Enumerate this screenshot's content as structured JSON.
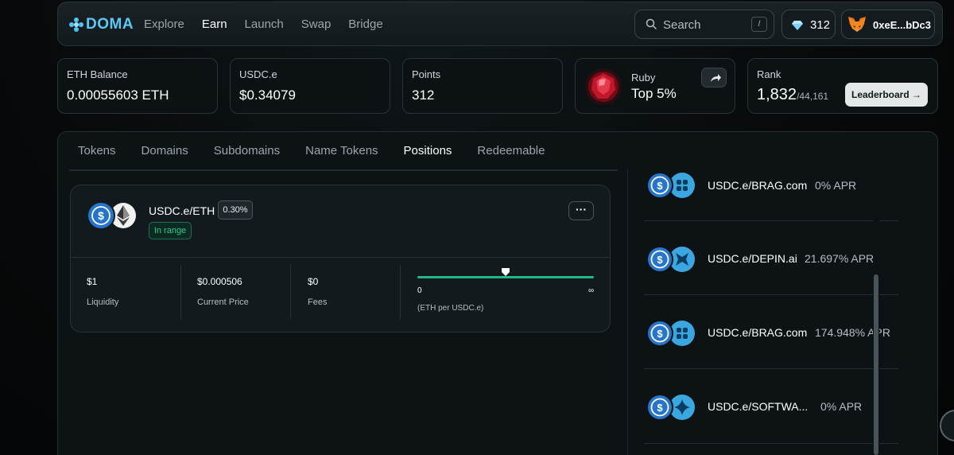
{
  "nav": {
    "logo": "DOMA",
    "links": [
      "Explore",
      "Earn",
      "Launch",
      "Swap",
      "Bridge"
    ],
    "active_link": "Earn",
    "search_placeholder": "Search",
    "search_shortcut": "/",
    "points": "312",
    "wallet": "0xeE...bDc3"
  },
  "stats": {
    "eth_balance": {
      "label": "ETH Balance",
      "value": "0.00055603 ETH"
    },
    "usdc": {
      "label": "USDC.e",
      "value": "$0.34079"
    },
    "points": {
      "label": "Points",
      "value": "312"
    },
    "ruby": {
      "label": "Ruby",
      "value": "Top 5%"
    },
    "rank": {
      "label": "Rank",
      "value": "1,832",
      "total": "/44,161",
      "button": "Leaderboard →"
    }
  },
  "tabs": [
    "Tokens",
    "Domains",
    "Subdomains",
    "Name Tokens",
    "Positions",
    "Redeemable"
  ],
  "active_tab": "Positions",
  "position": {
    "pair": "USDC.e/ETH",
    "fee": "0.30%",
    "status": "In range",
    "more": "···",
    "metrics": [
      {
        "value": "$1",
        "label": "Liquidity"
      },
      {
        "value": "$0.000506",
        "label": "Current Price"
      },
      {
        "value": "$0",
        "label": "Fees"
      }
    ],
    "range": {
      "min": "0",
      "max": "∞",
      "unit": "(ETH per USDC.e)",
      "marker_fraction": 0.5
    }
  },
  "pools": [
    {
      "name": "USDC.e/BRAG.com",
      "apr": "0% APR",
      "icon": "brag-icon"
    },
    {
      "name": "USDC.e/DEPIN.ai",
      "apr": "21.697% APR",
      "icon": "depin-icon"
    },
    {
      "name": "USDC.e/BRAG.com",
      "apr": "174.948% APR",
      "icon": "brag-icon"
    },
    {
      "name": "USDC.e/SOFTWA...",
      "apr": "0% APR",
      "icon": "software-icon"
    }
  ],
  "colors": {
    "accent": "#5ec8f5",
    "green": "#21b981",
    "usdc": "#2775ca"
  }
}
